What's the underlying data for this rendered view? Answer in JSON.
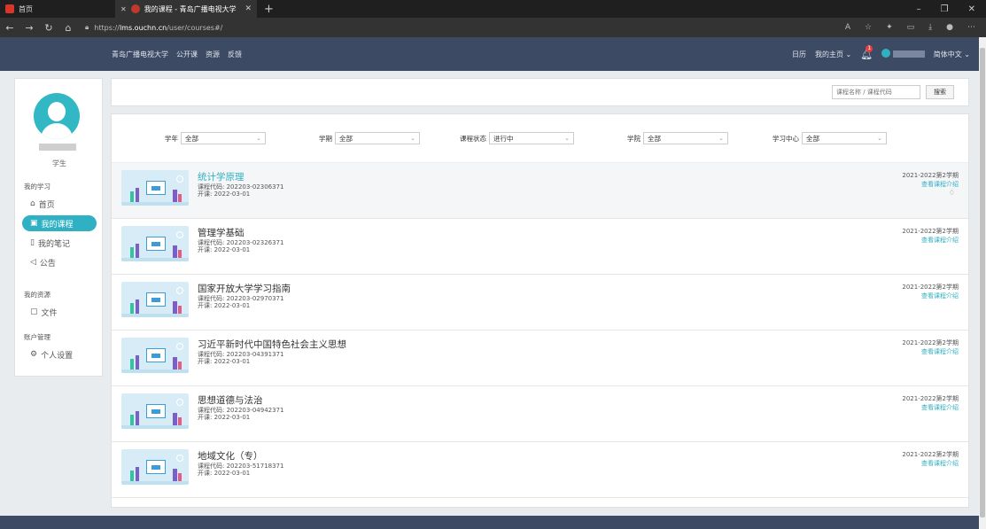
{
  "browser": {
    "tabs": [
      {
        "title": "首页",
        "active": false
      },
      {
        "title": "我的课程 - 青岛广播电视大学",
        "active": true
      }
    ],
    "url_prefix": "https://",
    "url_host": "lms.ouchn.cn",
    "url_path": "/user/courses#/"
  },
  "site": {
    "nav": [
      "青岛广播电视大学",
      "公开课",
      "资源",
      "反馈"
    ],
    "right": {
      "calendar": "日历",
      "home": "我的主页",
      "notification_count": "1",
      "language": "简体中文"
    }
  },
  "sidebar": {
    "role": "学生",
    "sections": [
      {
        "title": "我的学习",
        "items": [
          {
            "label": "首页",
            "icon": "home-icon",
            "active": false
          },
          {
            "label": "我的课程",
            "icon": "book-icon",
            "active": true
          },
          {
            "label": "我的笔记",
            "icon": "note-icon",
            "active": false
          },
          {
            "label": "公告",
            "icon": "announcement-icon",
            "active": false
          }
        ]
      },
      {
        "title": "我的资源",
        "items": [
          {
            "label": "文件",
            "icon": "file-icon",
            "active": false
          }
        ]
      },
      {
        "title": "账户管理",
        "items": [
          {
            "label": "个人设置",
            "icon": "settings-icon",
            "active": false
          }
        ]
      }
    ]
  },
  "search": {
    "placeholder": "课程名称 / 课程代码",
    "button": "搜索"
  },
  "filters": [
    {
      "label": "学年",
      "value": "全部"
    },
    {
      "label": "学期",
      "value": "全部"
    },
    {
      "label": "课程状态",
      "value": "进行中"
    },
    {
      "label": "学院",
      "value": "全部"
    },
    {
      "label": "学习中心",
      "value": "全部"
    }
  ],
  "courses": [
    {
      "title": "统计学原理",
      "code": "课程代码: 202203-02306371",
      "start": "开课: 2022-03-01",
      "term": "2021-2022第2学期",
      "link": "查看课程介绍"
    },
    {
      "title": "管理学基础",
      "code": "课程代码: 202203-02326371",
      "start": "开课: 2022-03-01",
      "term": "2021-2022第2学期",
      "link": "查看课程介绍"
    },
    {
      "title": "国家开放大学学习指南",
      "code": "课程代码: 202203-02970371",
      "start": "开课: 2022-03-01",
      "term": "2021-2022第2学期",
      "link": "查看课程介绍"
    },
    {
      "title": "习近平新时代中国特色社会主义思想",
      "code": "课程代码: 202203-04391371",
      "start": "开课: 2022-03-01",
      "term": "2021-2022第2学期",
      "link": "查看课程介绍"
    },
    {
      "title": "思想道德与法治",
      "code": "课程代码: 202203-04942371",
      "start": "开课: 2022-03-01",
      "term": "2021-2022第2学期",
      "link": "查看课程介绍"
    },
    {
      "title": "地域文化（专）",
      "code": "课程代码: 202203-51718371",
      "start": "开课: 2022-03-01",
      "term": "2021-2022第2学期",
      "link": "查看课程介绍"
    }
  ],
  "colors": {
    "accent": "#2fb0c3",
    "header": "#3d4a63",
    "page_bg": "#e9ecef"
  }
}
